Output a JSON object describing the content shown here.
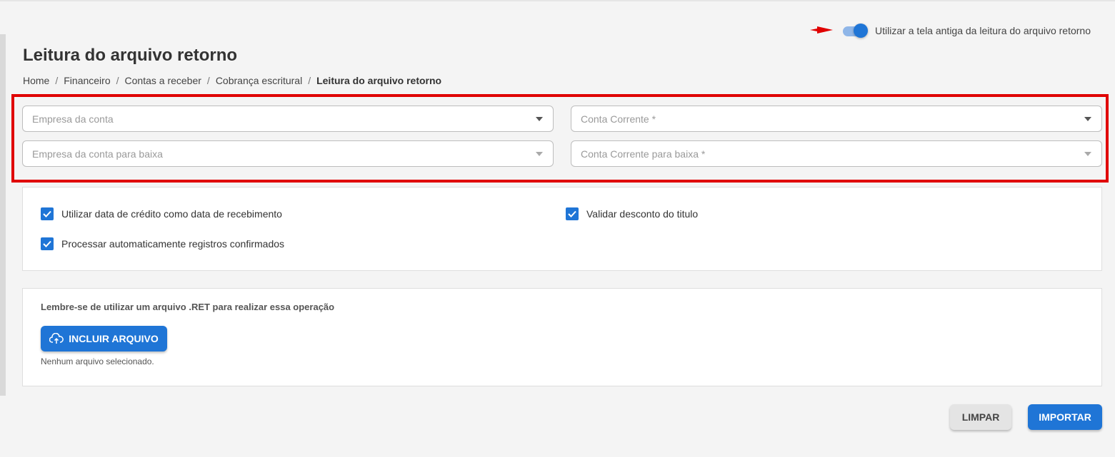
{
  "toggle": {
    "label": "Utilizar a tela antiga da leitura do arquivo retorno",
    "on": true
  },
  "page": {
    "title": "Leitura do arquivo retorno"
  },
  "breadcrumb": [
    "Home",
    "Financeiro",
    "Contas a receber",
    "Cobrança escritural",
    "Leitura do arquivo retorno"
  ],
  "fields": {
    "empresa_conta": "Empresa da conta",
    "conta_corrente": "Conta Corrente *",
    "empresa_conta_baixa": "Empresa da conta para baixa",
    "conta_corrente_baixa": "Conta Corrente para baixa *"
  },
  "options": {
    "usar_data_credito": "Utilizar data de crédito como data de recebimento",
    "validar_desconto": "Validar desconto do titulo",
    "processar_auto": "Processar automaticamente registros confirmados"
  },
  "upload": {
    "reminder": "Lembre-se de utilizar um arquivo .RET para realizar essa operação",
    "button": "INCLUIR ARQUIVO",
    "status": "Nenhum arquivo selecionado."
  },
  "actions": {
    "clear": "LIMPAR",
    "import": "IMPORTAR"
  },
  "colors": {
    "primary": "#1f75d6",
    "highlight": "#e00000"
  }
}
